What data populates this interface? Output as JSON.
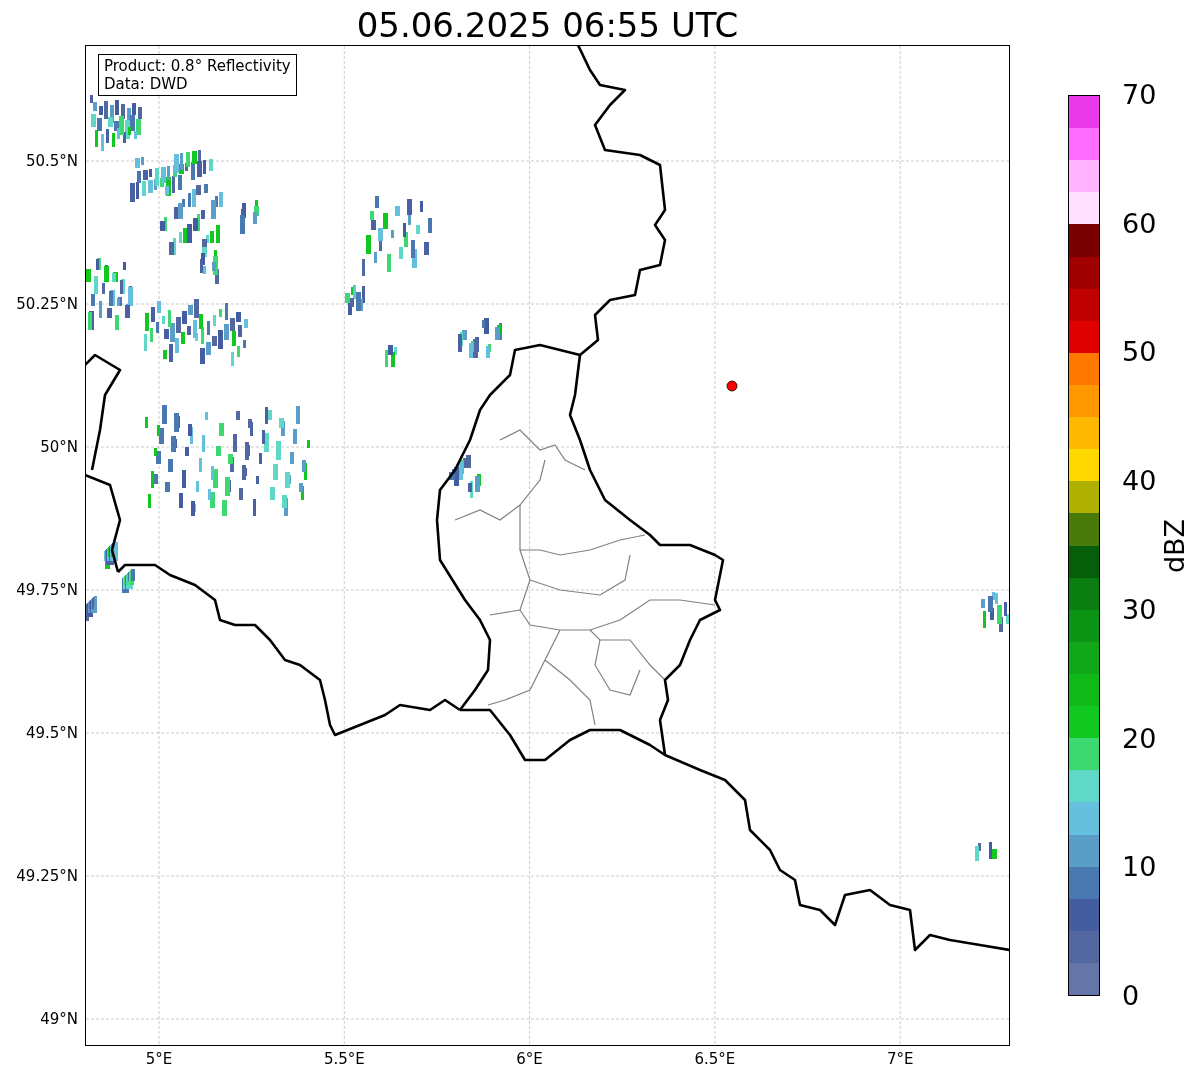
{
  "title": "05.06.2025 06:55 UTC",
  "map": {
    "info": [
      "Product: 0.8° Reflectivity",
      "Data: DWD"
    ],
    "xticks": [
      "5°E",
      "5.5°E",
      "6°E",
      "6.5°E",
      "7°E"
    ],
    "yticks": [
      "50.5°N",
      "50.25°N",
      "50°N",
      "49.75°N",
      "49.5°N",
      "49.25°N",
      "49°N"
    ]
  },
  "colorbar": {
    "label": "dBZ",
    "ticks": [
      "70",
      "60",
      "50",
      "40",
      "30",
      "20",
      "10",
      "0"
    ],
    "colors": [
      {
        "color": "#e838e8"
      },
      {
        "color": "#ff6cff"
      },
      {
        "color": "#ffb4ff"
      },
      {
        "color": "#ffe0ff"
      },
      {
        "color": "#780000"
      },
      {
        "color": "#a00000"
      },
      {
        "color": "#c00000"
      },
      {
        "color": "#e00000"
      },
      {
        "color": "#ff7800"
      },
      {
        "color": "#ff9800"
      },
      {
        "color": "#ffb800"
      },
      {
        "color": "#ffd800"
      },
      {
        "color": "#b0b000"
      },
      {
        "color": "#4a7a0a"
      },
      {
        "color": "#065e0a"
      },
      {
        "color": "#0a7e10"
      },
      {
        "color": "#0c9414"
      },
      {
        "color": "#10a818"
      },
      {
        "color": "#10b818"
      },
      {
        "color": "#10c820"
      },
      {
        "color": "#3dd870"
      },
      {
        "color": "#60d8c8"
      },
      {
        "color": "#64c0dc"
      },
      {
        "color": "#5a9ec8"
      },
      {
        "color": "#4a78b0"
      },
      {
        "color": "#445da0"
      },
      {
        "color": "#52689f"
      },
      {
        "color": "#6575a8"
      }
    ]
  }
}
